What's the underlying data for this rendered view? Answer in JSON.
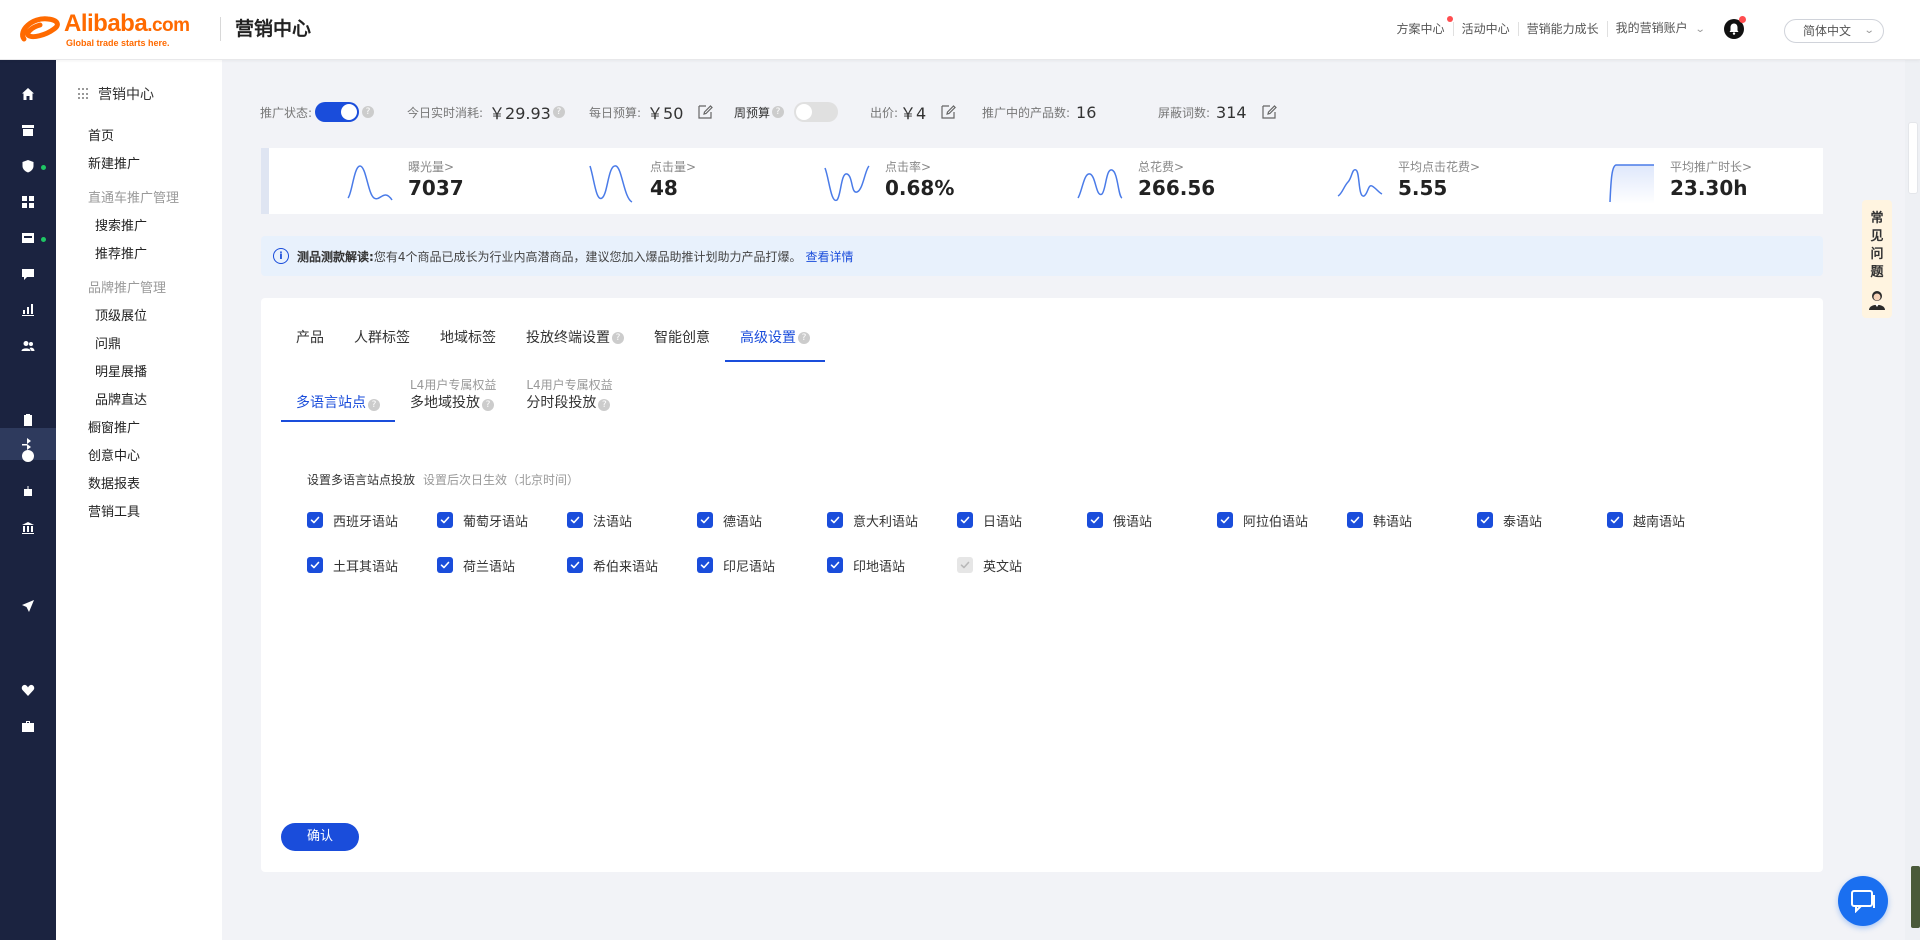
{
  "header": {
    "logo_brand": "Alibaba",
    "logo_domain": ".com",
    "logo_slogan": "Global trade starts here.",
    "app_title": "营销中心",
    "nav": [
      {
        "label": "方案中心",
        "badge": true
      },
      {
        "label": "活动中心",
        "badge": false
      },
      {
        "label": "营销能力成长",
        "badge": false
      },
      {
        "label": "我的营销账户",
        "badge": false
      }
    ],
    "language": "简体中文",
    "icons": {
      "bell": "bell-icon",
      "dropdown": "chevron-down-icon"
    }
  },
  "rail": {
    "icons": [
      "home-icon",
      "store-icon",
      "shield-icon",
      "apps-icon",
      "inbox-icon",
      "message-icon",
      "bar-chart-icon",
      "users-icon",
      "traffic-icon",
      "clipboard-icon",
      "globe-icon",
      "robot-icon",
      "bank-icon",
      "send-icon",
      "heart-icon",
      "briefcase-icon"
    ],
    "active_icon": "traffic-icon",
    "status_dot_color": "#1ec664"
  },
  "sidebar": {
    "title": "营销中心",
    "items": [
      {
        "label": "首页",
        "kind": "item"
      },
      {
        "label": "新建推广",
        "kind": "item"
      },
      {
        "label": "直通车推广管理",
        "kind": "group"
      },
      {
        "label": "搜索推广",
        "kind": "sub"
      },
      {
        "label": "推荐推广",
        "kind": "sub"
      },
      {
        "label": "品牌推广管理",
        "kind": "group"
      },
      {
        "label": "顶级展位",
        "kind": "sub"
      },
      {
        "label": "问鼎",
        "kind": "sub"
      },
      {
        "label": "明星展播",
        "kind": "sub"
      },
      {
        "label": "品牌直达",
        "kind": "sub"
      },
      {
        "label": "橱窗推广",
        "kind": "item"
      },
      {
        "label": "创意中心",
        "kind": "item"
      },
      {
        "label": "数据报表",
        "kind": "item"
      },
      {
        "label": "营销工具",
        "kind": "item"
      }
    ]
  },
  "status": {
    "promo_status_label": "推广状态:",
    "promo_status_on": true,
    "today_spend_label": "今日实时消耗:",
    "today_spend_value": "￥29.93",
    "daily_budget_label": "每日预算:",
    "daily_budget_value": "￥50",
    "weekly_budget_label": "周预算",
    "weekly_budget_on": false,
    "bid_label": "出价:",
    "bid_value": "￥4",
    "products_label": "推广中的产品数:",
    "products_value": "16",
    "blocked_words_label": "屏蔽词数:",
    "blocked_words_value": "314"
  },
  "kpis": [
    {
      "label": "曝光量>",
      "value": "7037"
    },
    {
      "label": "点击量>",
      "value": "48"
    },
    {
      "label": "点击率>",
      "value": "0.68%"
    },
    {
      "label": "总花费>",
      "value": "266.56"
    },
    {
      "label": "平均点击花费>",
      "value": "5.55"
    },
    {
      "label": "平均推广时长>",
      "value": "23.30h"
    }
  ],
  "notice": {
    "title": "测品测款解读:",
    "body": "您有4个商品已成长为行业内高潜商品，建议您加入爆品助推计划助力产品打爆。",
    "link": "查看详情"
  },
  "tabs": [
    {
      "label": "产品",
      "help": false,
      "active": false
    },
    {
      "label": "人群标签",
      "help": false,
      "active": false
    },
    {
      "label": "地域标签",
      "help": false,
      "active": false
    },
    {
      "label": "投放终端设置",
      "help": true,
      "active": false
    },
    {
      "label": "智能创意",
      "help": false,
      "active": false
    },
    {
      "label": "高级设置",
      "help": true,
      "active": true
    }
  ],
  "subtabs": [
    {
      "label": "多语言站点",
      "small": "",
      "active": true
    },
    {
      "label": "多地域投放",
      "small": "L4用户专属权益",
      "active": false
    },
    {
      "label": "分时段投放",
      "small": "L4用户专属权益",
      "active": false
    }
  ],
  "settings": {
    "title": "设置多语言站点投放",
    "note": "设置后次日生效（北京时间）",
    "sites": [
      {
        "label": "西班牙语站",
        "checked": true,
        "disabled": false
      },
      {
        "label": "葡萄牙语站",
        "checked": true,
        "disabled": false
      },
      {
        "label": "法语站",
        "checked": true,
        "disabled": false
      },
      {
        "label": "德语站",
        "checked": true,
        "disabled": false
      },
      {
        "label": "意大利语站",
        "checked": true,
        "disabled": false
      },
      {
        "label": "日语站",
        "checked": true,
        "disabled": false
      },
      {
        "label": "俄语站",
        "checked": true,
        "disabled": false
      },
      {
        "label": "阿拉伯语站",
        "checked": true,
        "disabled": false
      },
      {
        "label": "韩语站",
        "checked": true,
        "disabled": false
      },
      {
        "label": "泰语站",
        "checked": true,
        "disabled": false
      },
      {
        "label": "越南语站",
        "checked": true,
        "disabled": false
      },
      {
        "label": "土耳其语站",
        "checked": true,
        "disabled": false
      },
      {
        "label": "荷兰语站",
        "checked": true,
        "disabled": false
      },
      {
        "label": "希伯来语站",
        "checked": true,
        "disabled": false
      },
      {
        "label": "印尼语站",
        "checked": true,
        "disabled": false
      },
      {
        "label": "印地语站",
        "checked": true,
        "disabled": false
      },
      {
        "label": "英文站",
        "checked": true,
        "disabled": true
      }
    ],
    "confirm_label": "确认"
  },
  "float": {
    "faq_label": [
      "常",
      "见",
      "问",
      "题"
    ]
  },
  "colors": {
    "accent": "#1a4ddb",
    "brand": "#ff6a00",
    "rail_bg": "#1b2340"
  }
}
